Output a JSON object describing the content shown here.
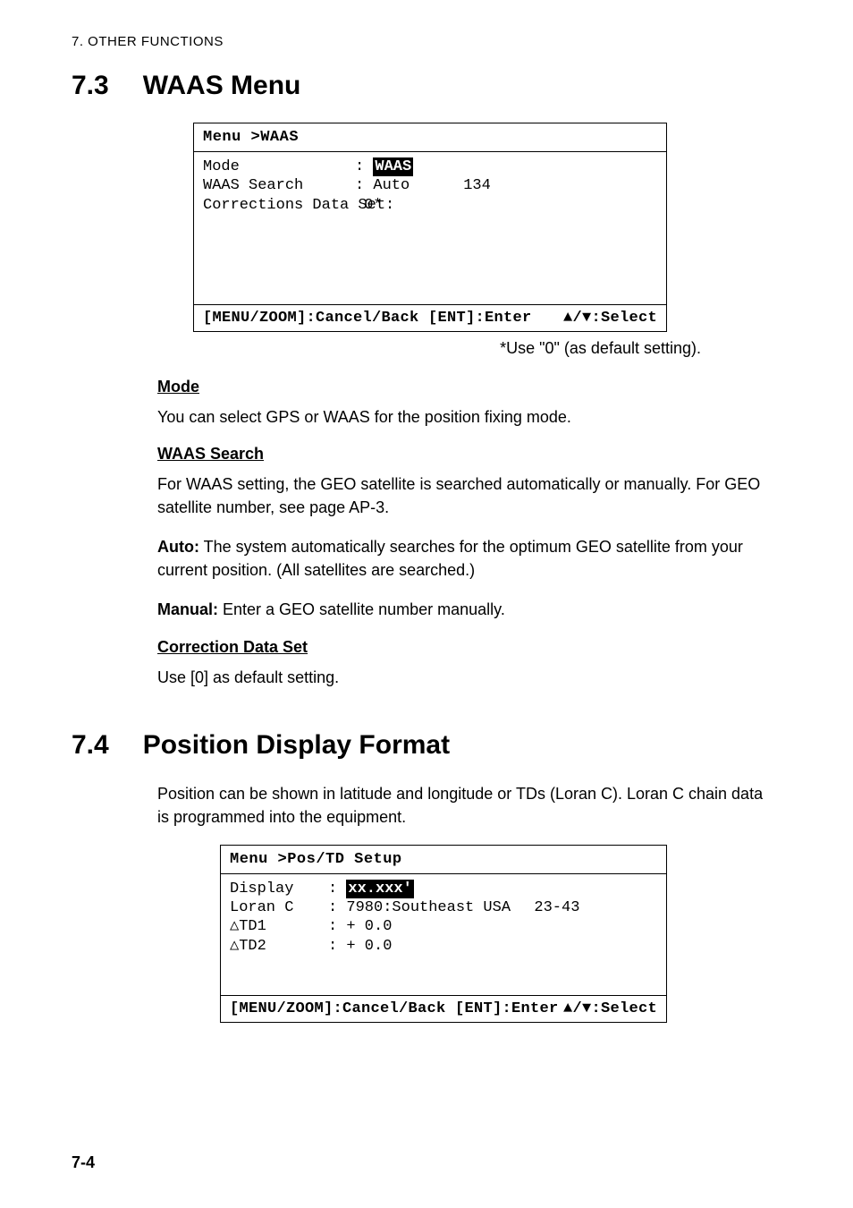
{
  "header": "7.  OTHER FUNCTIONS",
  "section1": {
    "number": "7.3",
    "title": "WAAS Menu",
    "menu": {
      "title": "Menu >WAAS",
      "rows": [
        {
          "label": "Mode",
          "sep": ": ",
          "value": "WAAS",
          "highlighted": true,
          "extra": ""
        },
        {
          "label": "WAAS Search",
          "sep": ": ",
          "value": "Auto",
          "highlighted": false,
          "extra": "134"
        },
        {
          "label": "Corrections Data Set:",
          "sep": " ",
          "value": "0*",
          "highlighted": false,
          "extra": ""
        }
      ],
      "footer_left": "[MENU/ZOOM]:Cancel/Back [ENT]:Enter",
      "footer_right": "▲/▼:Select"
    },
    "caption": "*Use \"0\" (as default setting).",
    "subsections": [
      {
        "heading": "Mode",
        "paragraphs": [
          {
            "text": "You can select GPS or WAAS for the position fixing mode."
          }
        ]
      },
      {
        "heading": "WAAS Search",
        "paragraphs": [
          {
            "text": "For WAAS setting, the GEO satellite is searched automatically or manually. For GEO satellite number, see page AP-3."
          },
          {
            "lead": "Auto:",
            "text": " The system automatically searches for the optimum GEO satellite from your current position. (All satellites are searched.)"
          },
          {
            "lead": "Manual:",
            "text": " Enter a GEO satellite number manually."
          }
        ]
      },
      {
        "heading": "Correction Data Set",
        "paragraphs": [
          {
            "text": "Use [0] as default setting."
          }
        ]
      }
    ]
  },
  "section2": {
    "number": "7.4",
    "title": "Position Display Format",
    "intro": "Position can be shown in latitude and longitude or TDs (Loran C). Loran C chain data is programmed into the equipment.",
    "menu": {
      "title": "Menu >Pos/TD Setup",
      "rows": [
        {
          "label": "Display",
          "sep": ": ",
          "value": "xx.xxx'",
          "highlighted": true,
          "extra": ""
        },
        {
          "label": "Loran C",
          "sep": ": ",
          "value": "7980:Southeast USA",
          "highlighted": false,
          "extra": "23-43"
        },
        {
          "label": "△TD1",
          "sep": ": ",
          "value": "+ 0.0",
          "highlighted": false,
          "extra": ""
        },
        {
          "label": "△TD2",
          "sep": ": ",
          "value": "+ 0.0",
          "highlighted": false,
          "extra": ""
        }
      ],
      "footer_left": "[MENU/ZOOM]:Cancel/Back [ENT]:Enter",
      "footer_right": "▲/▼:Select"
    }
  },
  "page_number": "7-4"
}
